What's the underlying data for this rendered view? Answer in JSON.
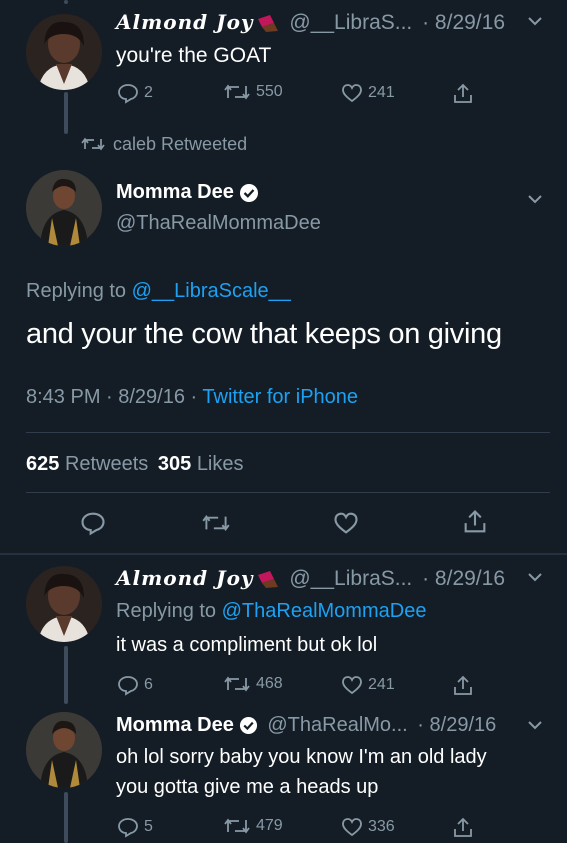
{
  "colors": {
    "background": "#141d26",
    "text_primary": "#ffffff",
    "text_muted": "#8899a6",
    "link_blue": "#1da1f2",
    "divider": "#2f3d4c",
    "verified": "#ffffff"
  },
  "tweet1": {
    "display_name": "Almond Joy",
    "handle": "@__LibraS...",
    "date": "· 8/29/16",
    "text": "you're the GOAT",
    "replies": "2",
    "retweets": "550",
    "likes": "241",
    "icons": [
      "reply-icon",
      "retweet-icon",
      "heart-icon",
      "share-icon",
      "chevron-down-icon",
      "chocolate-emoji-icon"
    ]
  },
  "retweet_context": {
    "text": "caleb Retweeted"
  },
  "main_tweet": {
    "display_name": "Momma Dee",
    "handle": "@ThaRealMommaDee",
    "replying_prefix": "Replying to ",
    "replying_to": "@__LibraScale__",
    "text": "and your the cow that keeps on giving",
    "time_date": "8:43 PM · 8/29/16 · ",
    "source": "Twitter for iPhone",
    "retweet_count": "625",
    "retweet_label": "Retweets",
    "like_count": "305",
    "like_label": "Likes"
  },
  "tweet3": {
    "display_name": "Almond Joy",
    "handle": "@__LibraS...",
    "date": "· 8/29/16",
    "replying_prefix": "Replying to ",
    "replying_to": "@ThaRealMommaDee",
    "text": "it was a compliment but ok lol",
    "replies": "6",
    "retweets": "468",
    "likes": "241"
  },
  "tweet4": {
    "display_name": "Momma Dee",
    "handle": "@ThaRealMo...",
    "date": "· 8/29/16",
    "text_line1": "oh lol sorry baby you know I'm an old lady",
    "text_line2": "you gotta give me a heads up",
    "replies": "5",
    "retweets": "479",
    "likes": "336"
  }
}
